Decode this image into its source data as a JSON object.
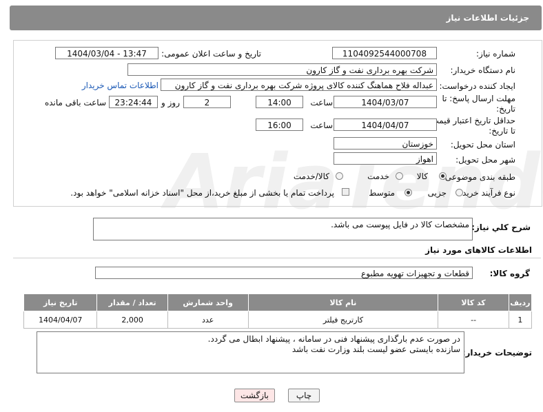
{
  "header": {
    "title": "جزئیات اطلاعات نیاز"
  },
  "fields": {
    "need_number_label": "شماره نیاز:",
    "need_number": "1104092544000708",
    "announce_label": "تاریخ و ساعت اعلان عمومی:",
    "announce_value": "1404/03/04 - 13:47",
    "buyer_org_label": "نام دستگاه خریدار:",
    "buyer_org": "شرکت بهره برداری نفت و گاز کارون",
    "creator_label": "ایجاد کننده درخواست:",
    "creator": "عبداله فلاح هماهنگ کننده کالای پروژه شرکت بهره برداری نفت و گاز کارون",
    "contact_link": "اطلاعات تماس خریدار",
    "reply_deadline_label_1": "مهلت ارسال پاسخ: تا",
    "reply_deadline_label_2": "تاریخ:",
    "reply_date": "1404/03/07",
    "time_label": "ساعت",
    "reply_time": "14:00",
    "days_value": "2",
    "days_label": "روز و",
    "remaining_time": "23:24:44",
    "remaining_label": "ساعت باقی مانده",
    "price_deadline_label_1": "حداقل تاریخ اعتبار قیمت:",
    "price_deadline_label_2": "تا تاریخ:",
    "price_date": "1404/04/07",
    "price_time": "16:00",
    "province_label": "استان محل تحویل:",
    "province": "خوزستان",
    "city_label": "شهر محل تحویل:",
    "city": "اهواز",
    "category_label": "طبقه بندی موضوعی:",
    "category_options": [
      "کالا",
      "خدمت",
      "کالا/خدمت"
    ],
    "process_label": "نوع فرآیند خرید :",
    "process_options": [
      "جزیی",
      "متوسط"
    ],
    "payment_note": "پرداخت تمام یا بخشی از مبلغ خرید،از محل \"اسناد خزانه اسلامی\" خواهد بود."
  },
  "summary": {
    "label": "شرح کلي نياز:",
    "text": "مشخصات کالا در فایل پیوست می باشد."
  },
  "goods": {
    "section_title": "اطلاعات کالاهای مورد نیاز",
    "group_label": "گروه کالا:",
    "group_value": "قطعات و تجهیزات تهویه مطبوع",
    "columns": [
      "ردیف",
      "کد کالا",
      "نام کالا",
      "واحد شمارش",
      "تعداد / مقدار",
      "تاریخ نیاز"
    ],
    "rows": [
      [
        "1",
        "--",
        "کارتریج فیلتر",
        "عدد",
        "2,000",
        "1404/04/07"
      ]
    ]
  },
  "notes": {
    "label": "توضیحات خریدار:",
    "line1": "در صورت عدم بارگذاری پیشنهاد فنی در سامانه ، پیشنهاد ابطال می گردد.",
    "line2": "سازنده بایستی عضو لیست بلند وزارت نفت باشد"
  },
  "buttons": {
    "print": "چاپ",
    "back": "بازگشت"
  },
  "colors": {
    "header_bg": "#8a8a8a",
    "link": "#1a58b5",
    "back_button_bg": "#fde6e6"
  }
}
